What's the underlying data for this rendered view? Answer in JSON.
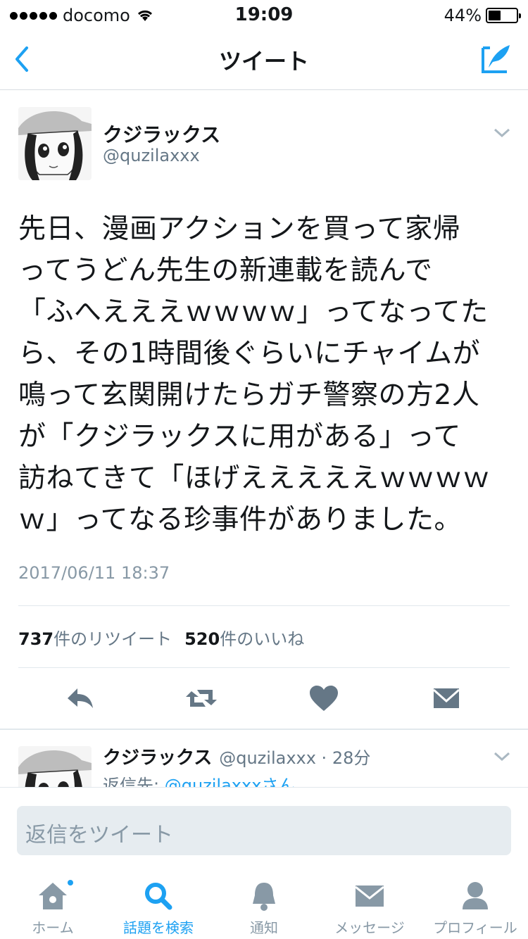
{
  "status_bar": {
    "carrier": "docomo",
    "time": "19:09",
    "battery_pct": "44%",
    "battery_level": 0.44
  },
  "nav": {
    "title": "ツイート",
    "back_icon": "chevron-left-icon",
    "compose_icon": "compose-tweet-icon"
  },
  "tweet": {
    "name": "クジラックス",
    "handle": "@quzilaxxx",
    "lines": [
      "先日、漫画アクションを買って家帰",
      "ってうどん先生の新連載を読んで",
      "「ふへえええｗｗｗｗ」ってなってた",
      "ら、その1時間後ぐらいにチャイムが",
      "鳴って玄関開けたらガチ警察の方2人",
      "が「クジラックスに用がある」って",
      "訪ねてきて「ほげえええええｗｗｗｗ",
      "ｗ」ってなる珍事件がありました。"
    ],
    "timestamp": "2017/06/11 18:37",
    "retweet_count": "737",
    "retweet_label": "件のリツイート",
    "like_count": "520",
    "like_label": "件のいいね"
  },
  "reply": {
    "name": "クジラックス",
    "handle_time": "@quzilaxxx · 28分",
    "reply_to_label": "返信先: ",
    "reply_to_link": "@quzilaxxxさん"
  },
  "composer": {
    "placeholder": "返信をツイート"
  },
  "tabs": [
    {
      "label": "ホーム",
      "icon": "home-icon",
      "active": false
    },
    {
      "label": "話題を検索",
      "icon": "search-icon",
      "active": true
    },
    {
      "label": "通知",
      "icon": "bell-icon",
      "active": false
    },
    {
      "label": "メッセージ",
      "icon": "envelope-icon",
      "active": false
    },
    {
      "label": "プロフィール",
      "icon": "person-icon",
      "active": false
    }
  ],
  "colors": {
    "accent": "#1da1f2",
    "muted": "#8899a6",
    "text": "#14171a"
  }
}
